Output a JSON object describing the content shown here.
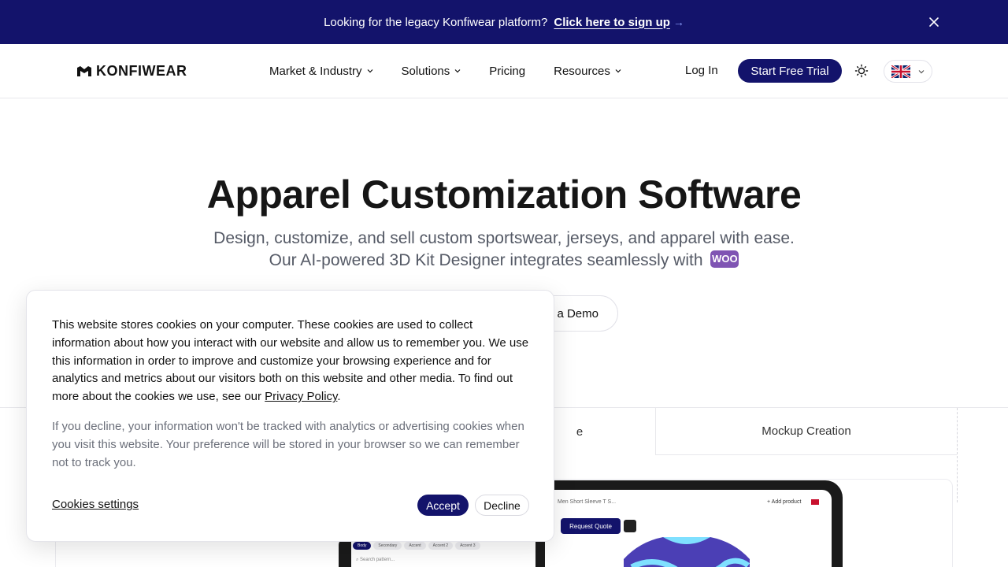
{
  "colors": {
    "brand": "#13136b",
    "woo": "#7f54b3"
  },
  "banner": {
    "message": "Looking for the legacy Konfiwear platform?",
    "cta": "Click here to sign up",
    "arrow": "→",
    "close_icon": "close-icon"
  },
  "nav": {
    "logo": "KONFIWEAR",
    "menu": [
      {
        "label": "Market & Industry",
        "has_dropdown": true
      },
      {
        "label": "Solutions",
        "has_dropdown": true
      },
      {
        "label": "Pricing",
        "has_dropdown": false
      },
      {
        "label": "Resources",
        "has_dropdown": true
      }
    ],
    "login": "Log In",
    "trial": "Start Free Trial",
    "theme_icon": "sun-icon",
    "language_icon": "uk-flag-icon"
  },
  "hero": {
    "title": "Apparel Customization Software",
    "subtitle_line1": "Design, customize, and sell custom sportswear, jerseys, and apparel with ease.",
    "subtitle_line2": "Our AI-powered 3D Kit Designer integrates seamlessly with",
    "woo_badge": "WOO",
    "demo_button": "a Demo"
  },
  "feature_tabs": [
    {
      "label": "e"
    },
    {
      "label": "Mockup Creation"
    }
  ],
  "preview": {
    "product_name": "Men Short Sleeve T S...",
    "add_product": "+ Add product",
    "request_quote": "Request Quote",
    "pills": [
      "Body",
      "Secondary",
      "Accent",
      "Accent 2",
      "Accent 3"
    ],
    "search_placeholder": "Search pattern..."
  },
  "cookie": {
    "text_main": "This website stores cookies on your computer. These cookies are used to collect information about how you interact with our website and allow us to remember you. We use this information in order to improve and customize your browsing experience and for analytics and metrics about our visitors both on this website and other media. To find out more about the cookies we use, see our",
    "privacy_link": "Privacy Policy",
    "text_end": ".",
    "text_decline": "If you decline, your information won't be tracked with analytics or advertising cookies when you visit this website. Your preference will be stored in your browser so we can remember not to track you.",
    "settings": "Cookies settings",
    "accept": "Accept",
    "decline": "Decline"
  }
}
